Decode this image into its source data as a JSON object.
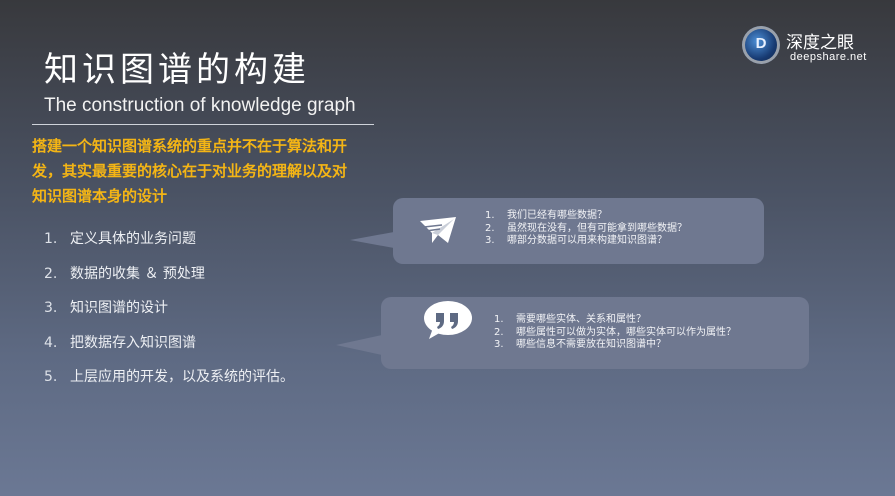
{
  "header": {
    "title": "知识图谱的构建",
    "subtitle": "The construction of knowledge graph"
  },
  "logo": {
    "mark": "D",
    "name": "深度之眼",
    "url": "deepshare.net"
  },
  "highlight": {
    "lines": [
      "搭建一个知识图谱系统的重点并不在于算法和开",
      "发，其实最重要的核心在于对业务的理解以及对",
      "知识图谱本身的设计"
    ],
    "color": "#f4b515"
  },
  "steps": [
    {
      "num": "1.",
      "text": "定义具体的业务问题"
    },
    {
      "num": "2.",
      "text": "数据的收集 ＆ 预处理"
    },
    {
      "num": "3.",
      "text": "知识图谱的设计"
    },
    {
      "num": "4.",
      "text": "把数据存入知识图谱"
    },
    {
      "num": "5.",
      "text": "上层应用的开发，以及系统的评估。"
    }
  ],
  "callouts": [
    {
      "icon": "paper-plane-icon",
      "items": [
        {
          "num": "1.",
          "text": "我们已经有哪些数据？"
        },
        {
          "num": "2.",
          "text": "虽然现在没有，但有可能拿到哪些数据？"
        },
        {
          "num": "3.",
          "text": "哪部分数据可以用来构建知识图谱？"
        }
      ]
    },
    {
      "icon": "quote-bubble-icon",
      "items": [
        {
          "num": "1.",
          "text": "需要哪些实体、关系和属性？"
        },
        {
          "num": "2.",
          "text": "哪些属性可以做为实体，哪些实体可以作为属性？"
        },
        {
          "num": "3.",
          "text": "哪些信息不需要放在知识图谱中？"
        }
      ]
    }
  ],
  "colors": {
    "callout_bg": "#6f7890",
    "accent": "#f4b515"
  }
}
